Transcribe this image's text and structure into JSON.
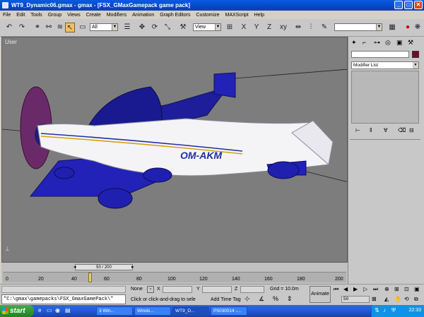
{
  "window": {
    "title": "WT9_Dynamic06.gmax - gmax - [FSX_GMaxGamepack game pack]",
    "min_glyph": "_",
    "max_glyph": "□",
    "close_glyph": "✕"
  },
  "menu": [
    "File",
    "Edit",
    "Tools",
    "Group",
    "Views",
    "Create",
    "Modifiers",
    "Animation",
    "Graph Editors",
    "Customize",
    "MAXScript",
    "Help"
  ],
  "toolbar": {
    "selection_filter": "All",
    "ref_coord": "View"
  },
  "viewport": {
    "label": "User",
    "aircraft_registration": "OM-AKM"
  },
  "command_panel": {
    "modifier_list": "Modifier List"
  },
  "timeline": {
    "frame_indicator": "50 / 200",
    "ticks": [
      "0",
      "20",
      "40",
      "60",
      "80",
      "100",
      "120",
      "140",
      "160",
      "180",
      "200"
    ]
  },
  "status": {
    "maxscript_line": "\"C:\\gmax\\gamepacks\\FSX_GmaxGamePack\\\"",
    "selection": "None",
    "x_label": "X",
    "y_label": "Y",
    "z_label": "Z",
    "grid": "Grid = 10.0m",
    "prompt": "Click or click-and-drag to sele",
    "add_time_tag": "Add Time Tag",
    "animate": "Animate",
    "current_frame": "50"
  },
  "taskbar": {
    "start": "start",
    "tasks": [
      "3 Win...",
      "Windo...",
      "WT9_D...",
      "P5030014 -..."
    ],
    "clock": "22:33"
  },
  "colors": {
    "title_blue": "#0546c8",
    "viewport_gray": "#7d7d7d",
    "fuselage_white": "#f4f4f6",
    "wing_blue": "#2222b8",
    "prop_disc": "#6a2a6a",
    "start_green": "#319b31"
  }
}
